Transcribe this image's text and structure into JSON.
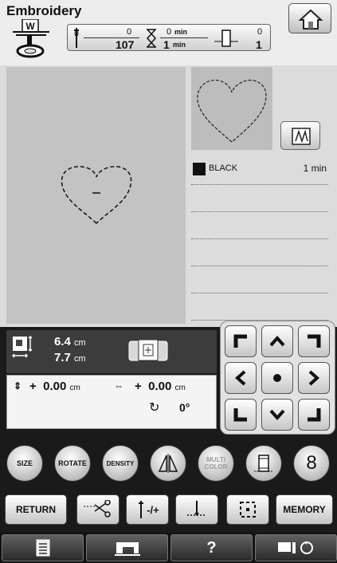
{
  "header": {
    "title": "Embroidery",
    "foot_code": "W",
    "stitch_current": "0",
    "stitch_total": "107",
    "time_current": "0",
    "time_total": "1",
    "time_unit": "min",
    "color_current": "0",
    "color_total": "1"
  },
  "thread_list": [
    {
      "name": "BLACK",
      "time": "1 min",
      "swatch_color": "#111111"
    }
  ],
  "size": {
    "width": "6.4",
    "height": "7.7",
    "unit": "cm"
  },
  "position": {
    "vertical_sign": "+",
    "vertical_value": "0.00",
    "horizontal_sign": "+",
    "horizontal_value": "0.00",
    "unit": "cm",
    "angle": "0°"
  },
  "round_buttons": {
    "size": "SIZE",
    "rotate": "ROTATE",
    "density": "DENSITY",
    "multi_color_1": "MULTI",
    "multi_color_2": "COLOR",
    "eight": "8"
  },
  "rect_buttons": {
    "return": "RETURN",
    "needle_pm": "-/+",
    "memory": "MEMORY"
  },
  "bottom_tabs": {
    "help": "?"
  }
}
